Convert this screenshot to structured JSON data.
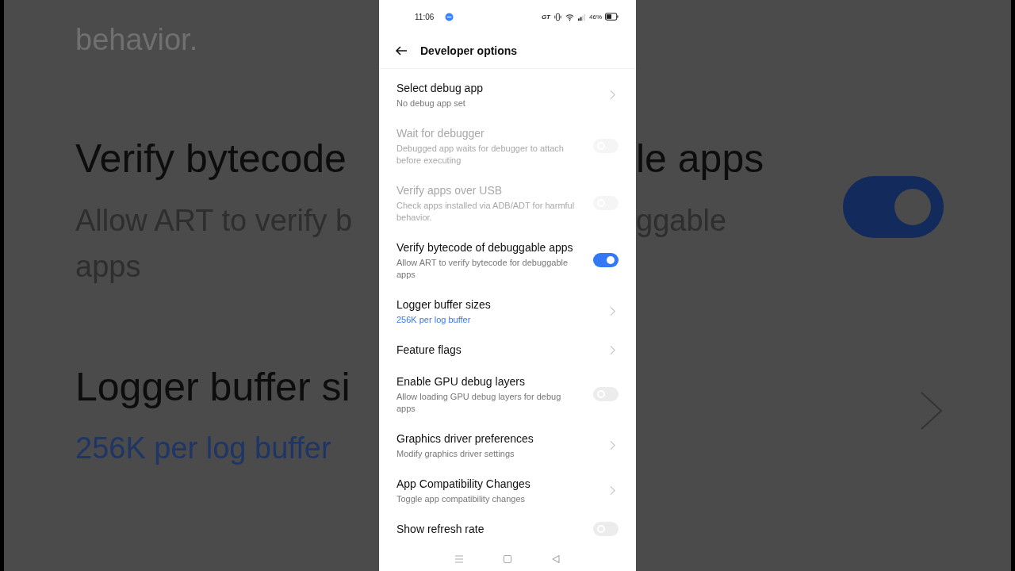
{
  "backdrop": {
    "left": [
      {
        "text": "behavior.",
        "kind": "faint"
      },
      {
        "text": "Verify bytecode",
        "kind": "title"
      },
      {
        "text": "Allow ART to verify b",
        "kind": "subtitle"
      },
      {
        "text": "apps",
        "kind": "subtitle"
      },
      {
        "text": "Logger buffer si",
        "kind": "title"
      },
      {
        "text": "256K per log buffer",
        "kind": "accent"
      }
    ],
    "right": [
      {
        "text": "le apps",
        "kind": "title"
      },
      {
        "text": "ggable",
        "kind": "subtitle"
      }
    ],
    "toggle_on": true
  },
  "status_bar": {
    "time": "11:06",
    "indicator": "GT",
    "battery": "46%"
  },
  "title": "Developer options",
  "items": [
    {
      "kind": "link",
      "title": "Select debug app",
      "subtitle": "No debug app set",
      "disabled": false
    },
    {
      "kind": "toggle",
      "title": "Wait for debugger",
      "subtitle": "Debugged app waits for debugger to attach before executing",
      "disabled": true,
      "on": false
    },
    {
      "kind": "toggle",
      "title": "Verify apps over USB",
      "subtitle": "Check apps installed via ADB/ADT for harmful behavior.",
      "disabled": true,
      "on": false
    },
    {
      "kind": "toggle",
      "title": "Verify bytecode of debuggable apps",
      "subtitle": "Allow ART to verify bytecode for debuggable apps",
      "disabled": false,
      "on": true
    },
    {
      "kind": "link",
      "title": "Logger buffer sizes",
      "subtitle": "256K per log buffer",
      "disabled": false,
      "accent": true
    },
    {
      "kind": "link",
      "title": "Feature flags",
      "disabled": false
    },
    {
      "kind": "toggle",
      "title": "Enable GPU debug layers",
      "subtitle": "Allow loading GPU debug layers for debug apps",
      "disabled": false,
      "on": false
    },
    {
      "kind": "link",
      "title": "Graphics driver preferences",
      "subtitle": "Modify graphics driver settings",
      "disabled": false
    },
    {
      "kind": "link",
      "title": "App Compatibility Changes",
      "subtitle": "Toggle app compatibility changes",
      "disabled": false
    },
    {
      "kind": "toggle",
      "title": "Show refresh rate",
      "disabled": false,
      "on": false
    }
  ]
}
